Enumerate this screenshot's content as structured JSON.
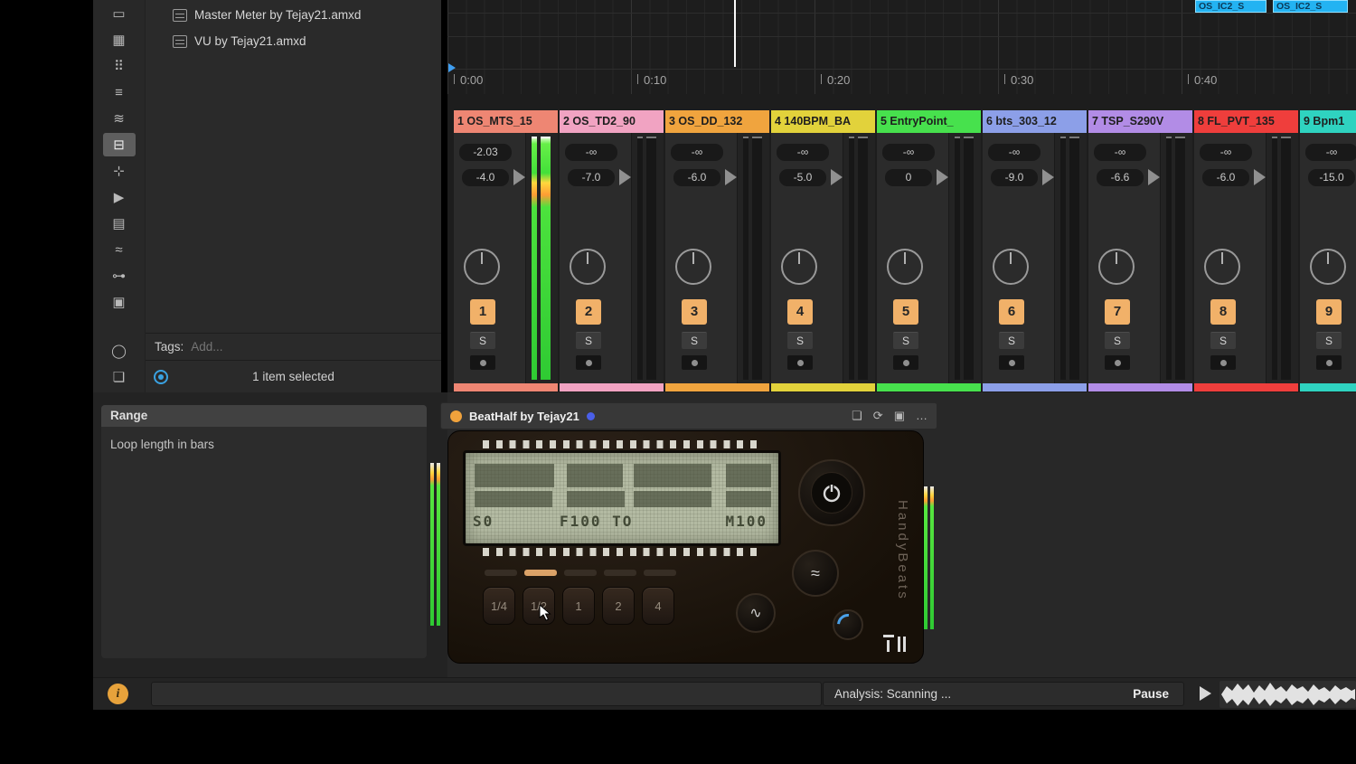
{
  "sidebar": {
    "items": [
      {
        "id": "sounds",
        "glyph": "▭"
      },
      {
        "id": "drums",
        "glyph": "▦"
      },
      {
        "id": "instruments",
        "glyph": "⠿"
      },
      {
        "id": "audio-effects",
        "glyph": "≡"
      },
      {
        "id": "midi-effects",
        "glyph": "≋"
      },
      {
        "id": "max-for-live",
        "glyph": "⊟",
        "selected": true
      },
      {
        "id": "plug-ins",
        "glyph": "⊹"
      },
      {
        "id": "clips",
        "glyph": "▶"
      },
      {
        "id": "samples",
        "glyph": "▤"
      },
      {
        "id": "grooves",
        "glyph": "≈"
      },
      {
        "id": "tuning",
        "glyph": "⊶"
      },
      {
        "id": "templates",
        "glyph": "▣"
      },
      {
        "id": "current-project",
        "glyph": "◯",
        "gap": true
      },
      {
        "id": "collections",
        "glyph": "❏"
      }
    ]
  },
  "browser": {
    "files": [
      {
        "label": "Master Meter by Tejay21.amxd"
      },
      {
        "label": "VU by Tejay21.amxd"
      }
    ],
    "tags_label": "Tags:",
    "tags_placeholder": "Add...",
    "status": "1 item selected"
  },
  "info_view": {
    "title": "Range",
    "body": "Loop length in bars"
  },
  "timeline": {
    "ruler": [
      {
        "label": "0:00"
      },
      {
        "label": "0:10"
      },
      {
        "label": "0:20"
      },
      {
        "label": "0:30"
      },
      {
        "label": "0:40"
      }
    ],
    "clips": [
      {
        "label": "OS_IC2_S"
      },
      {
        "label": "OS_IC2_S"
      }
    ]
  },
  "labels": {
    "solo": "S"
  },
  "tracks": [
    {
      "title": "1 OS_MTS_15",
      "color": "#ee8673",
      "peak": "-2.03",
      "gain": "-4.0",
      "num": "1",
      "lit": true
    },
    {
      "title": "2 OS_TD2_90",
      "color": "#f1a3c2",
      "peak": "-∞",
      "gain": "-7.0",
      "num": "2",
      "lit": false
    },
    {
      "title": "3 OS_DD_132",
      "color": "#f0a43e",
      "peak": "-∞",
      "gain": "-6.0",
      "num": "3",
      "lit": false
    },
    {
      "title": "4 140BPM_BA",
      "color": "#e2d23b",
      "peak": "-∞",
      "gain": "-5.0",
      "num": "4",
      "lit": false
    },
    {
      "title": "5 EntryPoint_",
      "color": "#47e14d",
      "peak": "-∞",
      "gain": "0",
      "num": "5",
      "lit": false
    },
    {
      "title": "6 bts_303_12",
      "color": "#8c9fe8",
      "peak": "-∞",
      "gain": "-9.0",
      "num": "6",
      "lit": false
    },
    {
      "title": "7 TSP_S290V",
      "color": "#b28ce6",
      "peak": "-∞",
      "gain": "-6.6",
      "num": "7",
      "lit": false
    },
    {
      "title": "8 FL_PVT_135",
      "color": "#ef3e3c",
      "peak": "-∞",
      "gain": "-6.0",
      "num": "8",
      "lit": false
    },
    {
      "title": "9 Bpm1",
      "color": "#2fd3c0",
      "peak": "-∞",
      "gain": "-15.0",
      "num": "9",
      "lit": false
    }
  ],
  "device": {
    "title": "BeatHalf by Tejay21",
    "icons": [
      {
        "id": "popout-window-icon",
        "glyph": "❏"
      },
      {
        "id": "hot-swap-icon",
        "glyph": "⟳"
      },
      {
        "id": "save-preset-icon",
        "glyph": "▣"
      },
      {
        "id": "more-options-icon",
        "glyph": "…"
      }
    ],
    "lcd": {
      "left": "S0",
      "mid": "F100 TO",
      "right": "M100"
    },
    "indicators": [
      false,
      true,
      false,
      false,
      false
    ],
    "buttons": [
      {
        "label": "1/4"
      },
      {
        "label": "1/2"
      },
      {
        "label": "1"
      },
      {
        "label": "2"
      },
      {
        "label": "4"
      }
    ],
    "brand": "HandyBeats"
  },
  "status_bar": {
    "analysis": "Analysis: Scanning ...",
    "pause": "Pause"
  }
}
